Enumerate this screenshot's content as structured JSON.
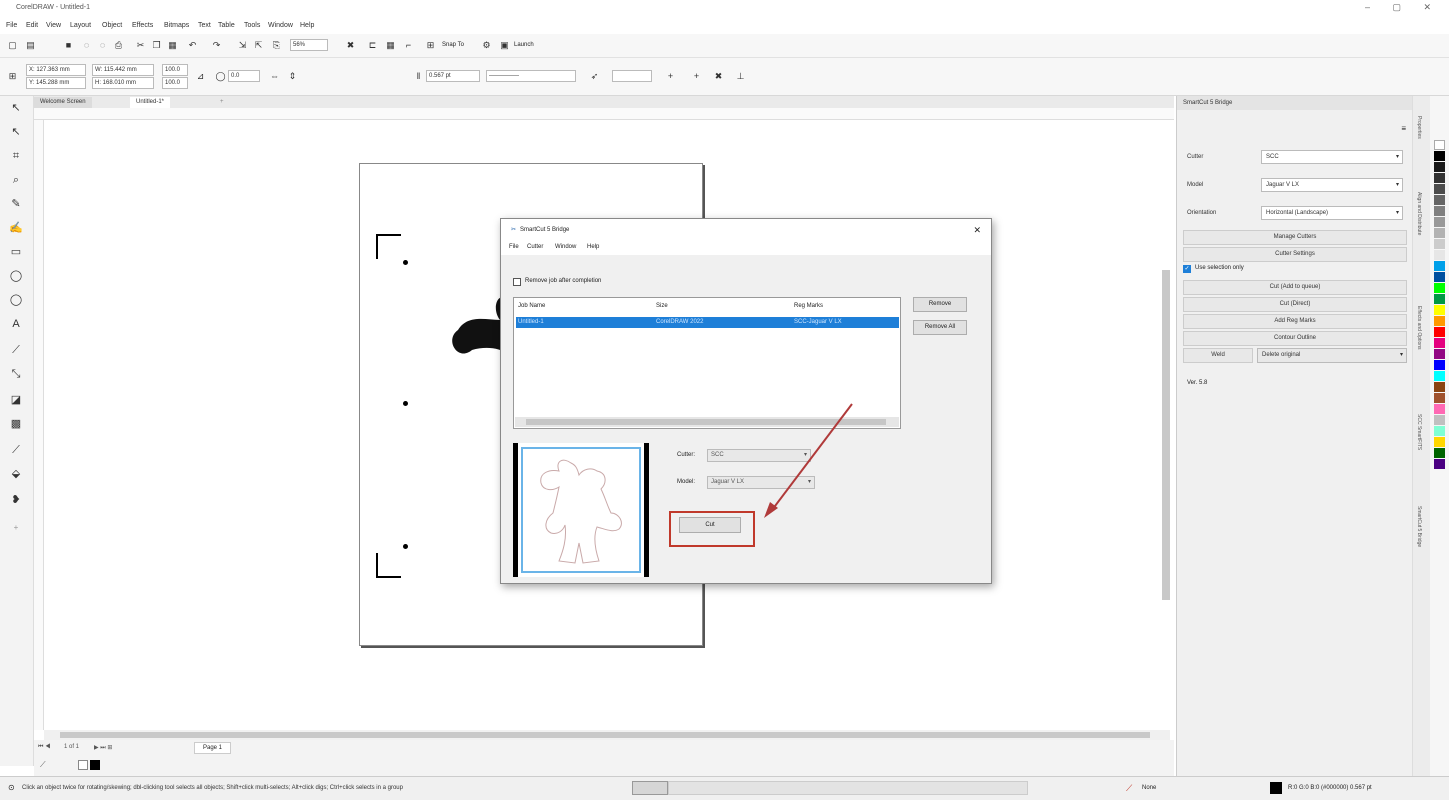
{
  "window": {
    "title": "CorelDRAW - Untitled-1"
  },
  "menu": [
    "File",
    "Edit",
    "View",
    "Layout",
    "Object",
    "Effects",
    "Bitmaps",
    "Text",
    "Table",
    "Tools",
    "Window",
    "Help"
  ],
  "toolbar": {
    "zoom": "56%",
    "snap_label": "Snap To",
    "launch_label": "Launch"
  },
  "propbar": {
    "x": "X: 127.363 mm",
    "y": "Y: 145.288 mm",
    "w": "W: 115.442 mm",
    "h": "H: 168.010 mm",
    "sx": "100.0",
    "sy": "100.0",
    "angle": "0.0",
    "outline": "0.567 pt"
  },
  "tabs": [
    "Welcome Screen",
    "Untitled-1*"
  ],
  "page_nav": {
    "counter": "1 of 1",
    "page_tab": "Page 1"
  },
  "status": {
    "hint": "Click an object twice for rotating/skewing; dbl-clicking tool selects all objects; Shift+click multi-selects; Alt+click digs; Ctrl+click selects in a group",
    "fill": "None",
    "outline": "R:0 G:0 B:0 (#000000) 0.567 pt"
  },
  "docker": {
    "title": "SmartCut 5 Bridge",
    "cutter_label": "Cutter",
    "cutter_value": "SCC",
    "model_label": "Model",
    "model_value": "Jaguar V LX",
    "orientation_label": "Orientation",
    "orientation_value": "Horizontal (Landscape)",
    "buttons": [
      "Manage Cutters",
      "Cutter Settings",
      "Cut (Add to queue)",
      "Cut (Direct)",
      "Add Reg Marks",
      "Contour Outline"
    ],
    "use_selection_label": "Use selection only",
    "weld_label": "Weld",
    "delete_original": "Delete original",
    "version": "Ver. 5.8"
  },
  "docker_tabs": [
    "Properties",
    "Align and Distribute",
    "Effects and Options",
    "SCC SmartFITS",
    "SmartCut 5 Bridge"
  ],
  "palette_colors": [
    "#ffffff",
    "#000000",
    "#1a1a1a",
    "#333333",
    "#4d4d4d",
    "#666666",
    "#808080",
    "#999999",
    "#b3b3b3",
    "#cccccc",
    "#e6e6e6",
    "#00a0e9",
    "#0050a0",
    "#00ff00",
    "#009944",
    "#ffff00",
    "#ff9900",
    "#ff0000",
    "#e4007f",
    "#920783",
    "#0000ff",
    "#00ffff",
    "#8b4513",
    "#a0522d",
    "#ff69b4",
    "#c0c0c0",
    "#7fffd4",
    "#ffd700",
    "#006400",
    "#4b0082"
  ],
  "dialog": {
    "title": "SmartCut 5 Bridge",
    "menu": [
      "File",
      "Cutter",
      "Window",
      "Help"
    ],
    "remove_job_label": "Remove job after completion",
    "columns": [
      "Job Name",
      "Size",
      "Reg Marks"
    ],
    "jobs": [
      {
        "name": "Untitled-1",
        "size": "CorelDRAW 2022",
        "reg": "SCC-Jaguar V LX"
      }
    ],
    "remove_btn": "Remove",
    "remove_all_btn": "Remove All",
    "cutter_label": "Cutter:",
    "cutter_value": "SCC",
    "model_label": "Model:",
    "model_value": "Jaguar V LX",
    "cut_btn": "Cut"
  }
}
